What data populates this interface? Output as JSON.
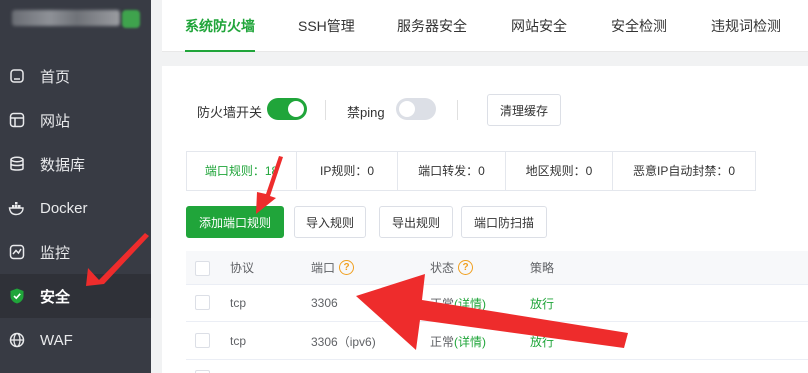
{
  "sidebar": {
    "items": [
      {
        "label": "首页",
        "icon": "home-icon"
      },
      {
        "label": "网站",
        "icon": "website-icon"
      },
      {
        "label": "数据库",
        "icon": "database-icon"
      },
      {
        "label": "Docker",
        "icon": "docker-icon"
      },
      {
        "label": "监控",
        "icon": "monitor-icon"
      },
      {
        "label": "安全",
        "icon": "shield-icon",
        "active": true
      },
      {
        "label": "WAF",
        "icon": "globe-icon"
      }
    ]
  },
  "tabs": [
    "系统防火墙",
    "SSH管理",
    "服务器安全",
    "网站安全",
    "安全检测",
    "违规词检测"
  ],
  "controls": {
    "firewall_label": "防火墙开关",
    "firewall_on": true,
    "ping_label": "禁ping",
    "ping_on": false,
    "clear_cache": "清理缓存"
  },
  "subtabs": [
    "端口规则：18",
    "IP规则：0",
    "端口转发：0",
    "地区规则：0",
    "恶意IP自动封禁：0"
  ],
  "actions": {
    "add_port": "添加端口规则",
    "import": "导入规则",
    "export": "导出规则",
    "anti_scan": "端口防扫描"
  },
  "table": {
    "headers": [
      "协议",
      "端口",
      "状态",
      "策略"
    ],
    "rows": [
      {
        "protocol": "tcp",
        "port": "3306",
        "status": "正常",
        "detail": "(详情)",
        "policy": "放行"
      },
      {
        "protocol": "tcp",
        "port": "3306（ipv6)",
        "status": "正常",
        "detail": "(详情)",
        "policy": "放行"
      }
    ]
  },
  "colors": {
    "accent": "#20a53a",
    "sidebar": "#383b44",
    "annotation": "#ee2c2c"
  }
}
